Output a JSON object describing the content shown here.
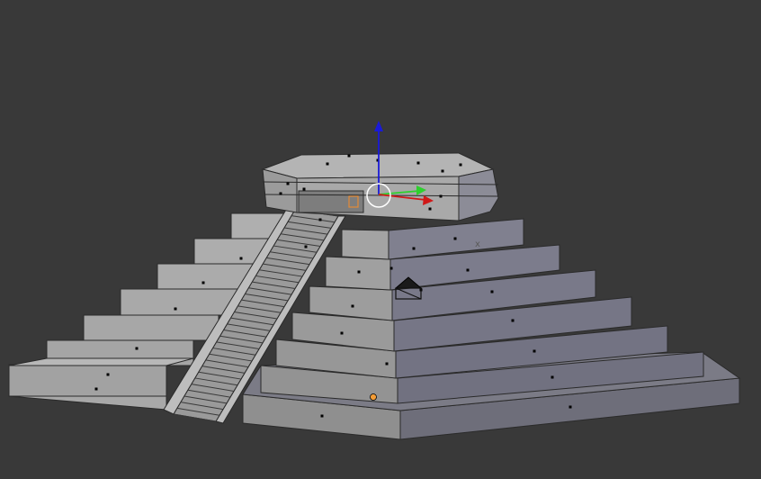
{
  "app": {
    "name": "",
    "viewport_background": "#393939"
  },
  "scene": {
    "object": "stepped-pyramid-mesh",
    "mode": "edit-mode",
    "mesh_colors": {
      "face_light": "#a4a4a4",
      "face_side": "#878787",
      "face_dark": "#6f6f78",
      "face_top": "#b4b4b4",
      "edge": "#2a2a2a",
      "vertex": "#000000"
    },
    "gizmo": {
      "x_axis_color": "#d01818",
      "y_axis_color": "#2ed02e",
      "z_axis_color": "#1a1ad8",
      "pivot_color": "#ffffff"
    },
    "origin_marker_color": "#f39c36",
    "selected_marker_color": "#e38a36"
  },
  "icons": {
    "camera": "camera-icon",
    "transform_gizmo": "transform-gizmo-icon",
    "origin": "origin-dot-icon"
  }
}
